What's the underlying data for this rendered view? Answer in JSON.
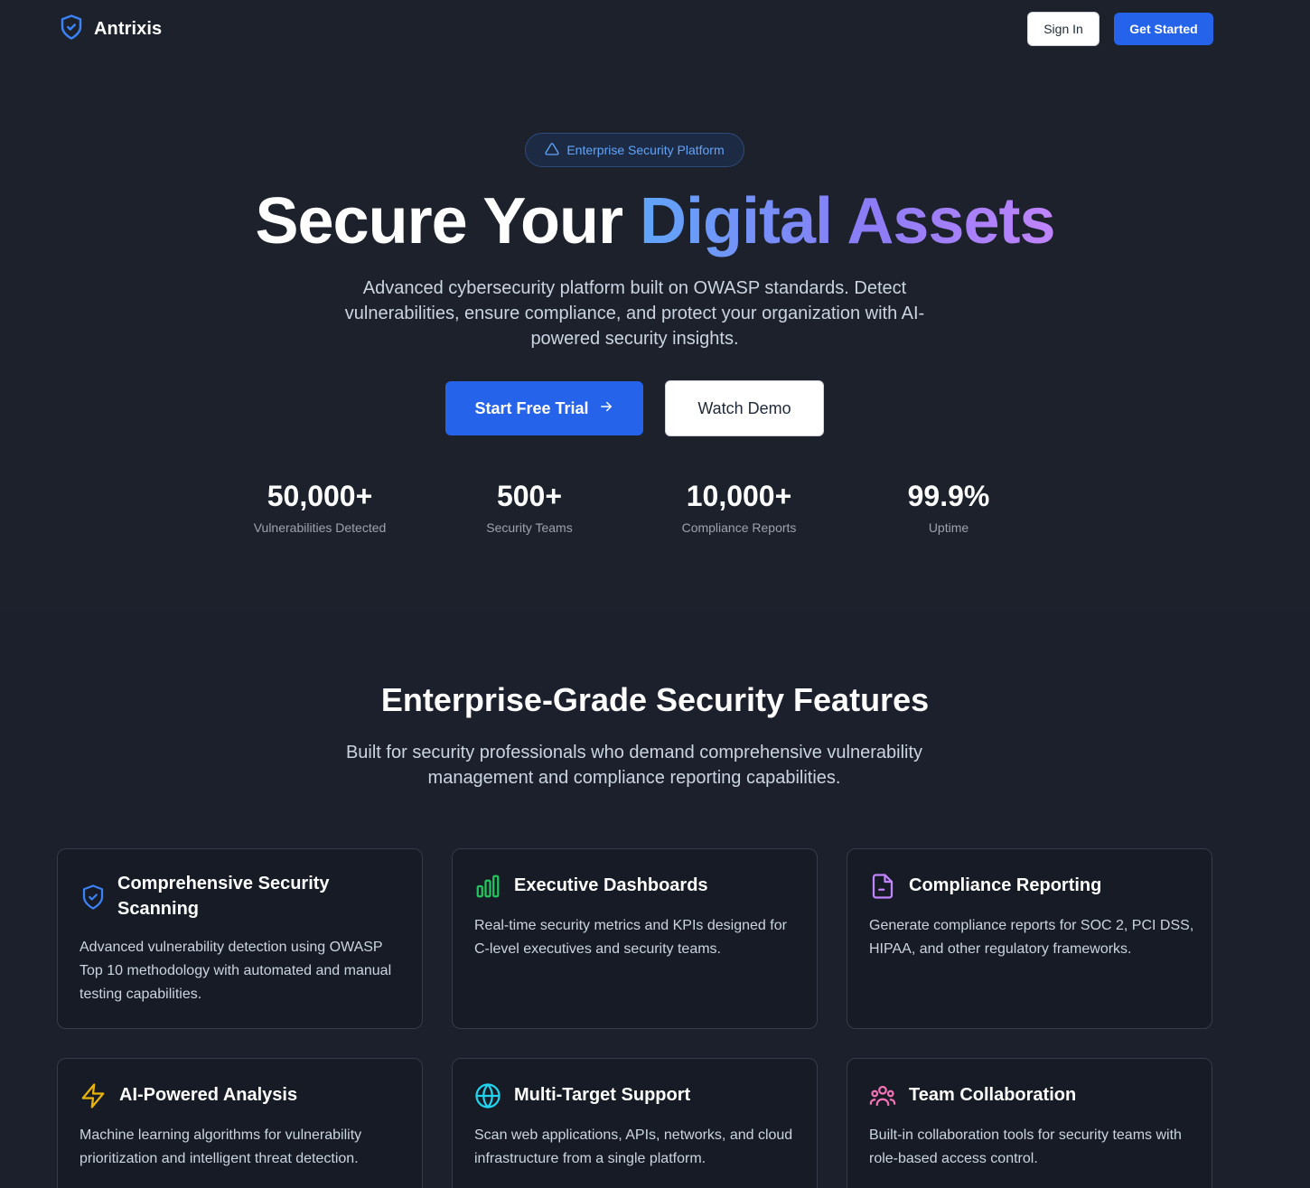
{
  "nav": {
    "brand": "Antrixis",
    "signin_label": "Sign In",
    "getstarted_label": "Get Started"
  },
  "hero": {
    "badge": "Enterprise Security Platform",
    "headline_plain": "Secure Your ",
    "headline_gradient": "Digital Assets",
    "subtext": "Advanced cybersecurity platform built on OWASP standards. Detect vulnerabilities, ensure compliance, and protect your organization with AI-powered security insights.",
    "cta_primary": "Start Free Trial",
    "cta_secondary": "Watch Demo"
  },
  "stats": [
    {
      "value": "50,000+",
      "label": "Vulnerabilities Detected"
    },
    {
      "value": "500+",
      "label": "Security Teams"
    },
    {
      "value": "10,000+",
      "label": "Compliance Reports"
    },
    {
      "value": "99.9%",
      "label": "Uptime"
    }
  ],
  "features": {
    "title": "Enterprise-Grade Security Features",
    "subtitle": "Built for security professionals who demand comprehensive vulnerability management and compliance reporting capabilities.",
    "cards": [
      {
        "icon": "shield-check-icon",
        "title": "Comprehensive Security Scanning",
        "desc": "Advanced vulnerability detection using OWASP Top 10 methodology with automated and manual testing capabilities."
      },
      {
        "icon": "bar-chart-icon",
        "title": "Executive Dashboards",
        "desc": "Real-time security metrics and KPIs designed for C-level executives and security teams."
      },
      {
        "icon": "file-text-icon",
        "title": "Compliance Reporting",
        "desc": "Generate compliance reports for SOC 2, PCI DSS, HIPAA, and other regulatory frameworks."
      },
      {
        "icon": "zap-icon",
        "title": "AI-Powered Analysis",
        "desc": "Machine learning algorithms for vulnerability prioritization and intelligent threat detection."
      },
      {
        "icon": "globe-icon",
        "title": "Multi-Target Support",
        "desc": "Scan web applications, APIs, networks, and cloud infrastructure from a single platform."
      },
      {
        "icon": "users-icon",
        "title": "Team Collaboration",
        "desc": "Built-in collaboration tools for security teams with role-based access control."
      }
    ]
  },
  "colors": {
    "accent_blue": "#2563eb",
    "badge_text": "#60a5fa",
    "gradient_start": "#60a5fa",
    "gradient_end": "#c084fc",
    "icon_blue": "#3b82f6",
    "icon_green": "#22c55e",
    "icon_purple": "#c084fc",
    "icon_yellow": "#eab308",
    "icon_cyan": "#22d3ee",
    "icon_pink": "#f472b6"
  }
}
